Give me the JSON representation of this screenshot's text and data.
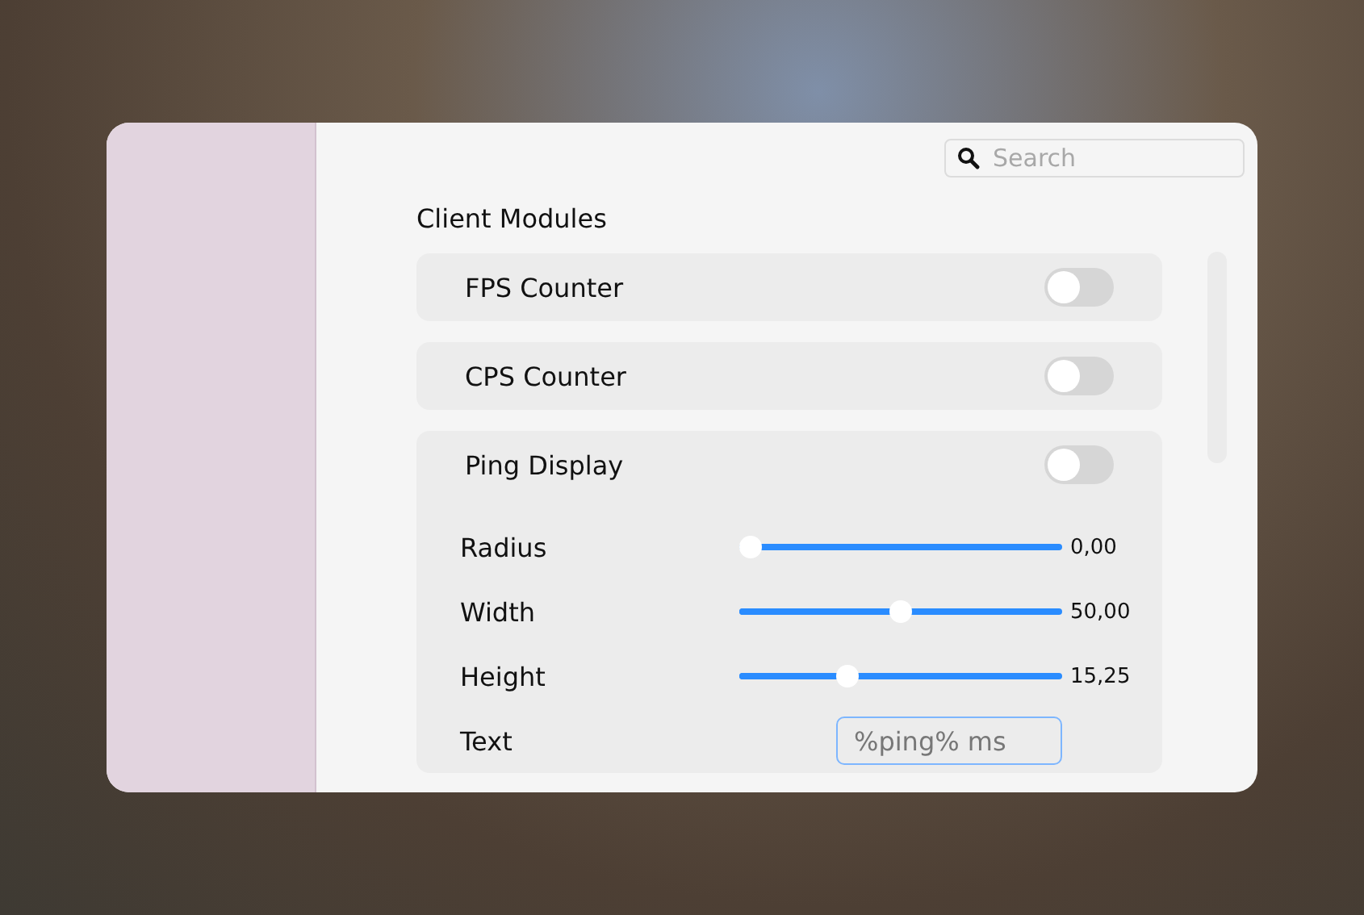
{
  "search": {
    "placeholder": "Search"
  },
  "section_title": "Client Modules",
  "modules": [
    {
      "name": "FPS Counter",
      "on": false
    },
    {
      "name": "CPS Counter",
      "on": false
    },
    {
      "name": "Ping Display",
      "on": false,
      "settings": [
        {
          "kind": "slider",
          "label": "Radius",
          "level": 0.0,
          "reading": "0,00"
        },
        {
          "kind": "slider",
          "label": "Width",
          "level": 0.5,
          "reading": "50,00"
        },
        {
          "kind": "slider",
          "label": "Height",
          "level": 0.32,
          "reading": "15,25"
        },
        {
          "kind": "text",
          "label": "Text",
          "value": "%ping% ms"
        }
      ]
    }
  ]
}
